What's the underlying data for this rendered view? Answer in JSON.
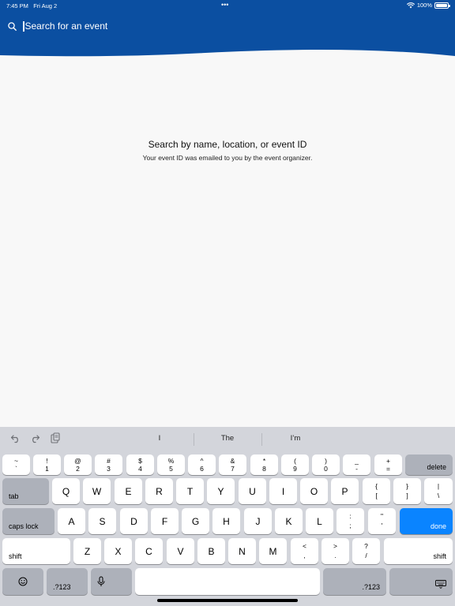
{
  "status_bar": {
    "time": "7:45 PM",
    "date": "Fri Aug 2",
    "dots": "•••",
    "battery": "100%"
  },
  "header": {
    "background_color": "#0b4fa1",
    "search_placeholder": "Search for an event"
  },
  "empty_state": {
    "title": "Search by name, location, or event ID",
    "subtitle": "Your event ID was emailed to you by the event organizer."
  },
  "keyboard": {
    "suggestions": [
      "I",
      "The",
      "I’m"
    ],
    "number_row": [
      {
        "top": "~",
        "bottom": "`"
      },
      {
        "top": "!",
        "bottom": "1"
      },
      {
        "top": "@",
        "bottom": "2"
      },
      {
        "top": "#",
        "bottom": "3"
      },
      {
        "top": "$",
        "bottom": "4"
      },
      {
        "top": "%",
        "bottom": "5"
      },
      {
        "top": "^",
        "bottom": "6"
      },
      {
        "top": "&",
        "bottom": "7"
      },
      {
        "top": "*",
        "bottom": "8"
      },
      {
        "top": "(",
        "bottom": "9"
      },
      {
        "top": ")",
        "bottom": "0"
      },
      {
        "top": "_",
        "bottom": "-"
      },
      {
        "top": "+",
        "bottom": "="
      }
    ],
    "delete_label": "delete",
    "tab_label": "tab",
    "row_q": [
      "Q",
      "W",
      "E",
      "R",
      "T",
      "Y",
      "U",
      "I",
      "O",
      "P"
    ],
    "row_q_extra": [
      {
        "top": "{",
        "bottom": "["
      },
      {
        "top": "}",
        "bottom": "]"
      },
      {
        "top": "|",
        "bottom": "\\"
      }
    ],
    "caps_label": "caps lock",
    "row_a": [
      "A",
      "S",
      "D",
      "F",
      "G",
      "H",
      "J",
      "K",
      "L"
    ],
    "row_a_extra": [
      {
        "top": ":",
        "bottom": ";"
      },
      {
        "top": "\"",
        "bottom": "'"
      }
    ],
    "done_label": "done",
    "shift_label": "shift",
    "row_z": [
      "Z",
      "X",
      "C",
      "V",
      "B",
      "N",
      "M"
    ],
    "row_z_extra": [
      {
        "top": "<",
        "bottom": ","
      },
      {
        "top": ">",
        "bottom": "."
      },
      {
        "top": "?",
        "bottom": "/"
      }
    ],
    "numbers_label": ".?123"
  }
}
